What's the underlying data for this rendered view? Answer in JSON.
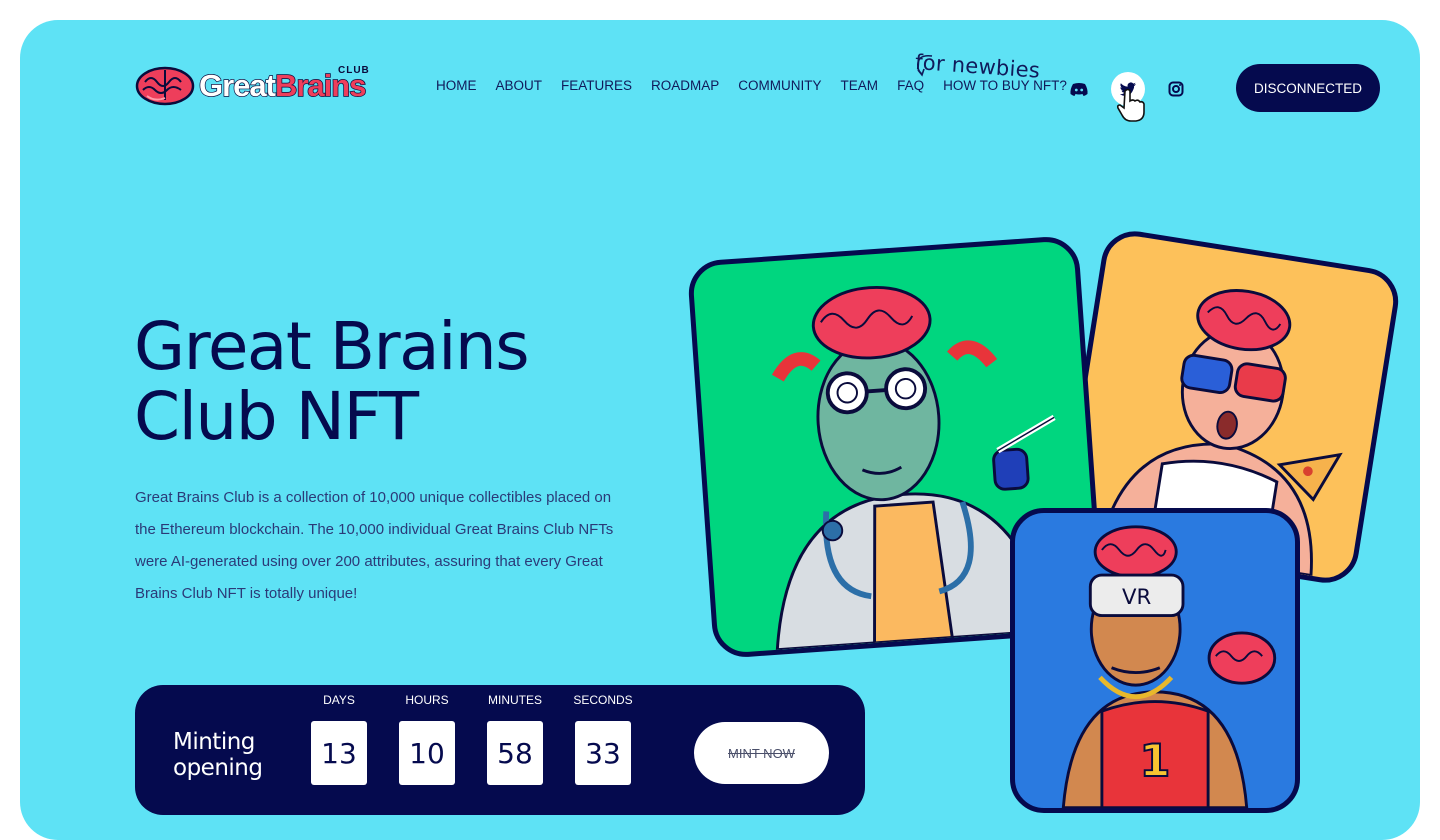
{
  "header": {
    "logo": {
      "main": "Great",
      "accent": "Brains",
      "tag": "CLUB"
    },
    "nav": [
      {
        "label": "HOME"
      },
      {
        "label": "ABOUT"
      },
      {
        "label": "FEATURES"
      },
      {
        "label": "ROADMAP"
      },
      {
        "label": "COMMUNITY"
      },
      {
        "label": "TEAM"
      },
      {
        "label": "FAQ"
      },
      {
        "label": "HOW TO BUY NFT?"
      }
    ],
    "newbies_note": "for newbies",
    "social": [
      "discord-icon",
      "twitter-icon",
      "instagram-icon"
    ],
    "connect_button": "DISCONNECTED"
  },
  "hero": {
    "title_line1": "Great Brains",
    "title_line2": "Club NFT",
    "description": "Great Brains Club is a collection of 10,000 unique collectibles placed on the Ethereum blockchain. The 10,000 individual Great Brains Club NFTs were AI-generated using over 200 attributes, assuring that every Great Brains Club NFT is totally unique!"
  },
  "mint": {
    "label_line1": "Minting",
    "label_line2": "opening",
    "countdown": [
      {
        "label": "DAYS",
        "value": "13"
      },
      {
        "label": "HOURS",
        "value": "10"
      },
      {
        "label": "MINUTES",
        "value": "58"
      },
      {
        "label": "SECONDS",
        "value": "33"
      }
    ],
    "button": "MINT NOW"
  },
  "cards": {
    "vr_text": "VR",
    "jersey_number": "1"
  },
  "colors": {
    "background": "#5ee2f5",
    "navy": "#050a4e",
    "brain_pink": "#ee3e5b",
    "card_green": "#00d67f",
    "card_orange": "#fdc15a",
    "card_blue": "#2a7ae0"
  }
}
